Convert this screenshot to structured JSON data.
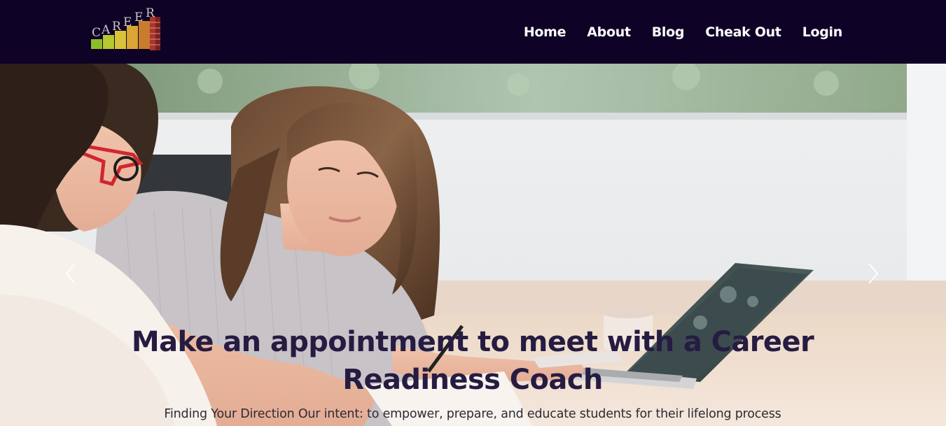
{
  "brand": {
    "logo_text": "CAREER",
    "logo_icon": "career-ladder-logo"
  },
  "nav": {
    "items": [
      {
        "label": "Home"
      },
      {
        "label": "About"
      },
      {
        "label": "Blog"
      },
      {
        "label": "Cheak Out"
      },
      {
        "label": "Login"
      }
    ]
  },
  "hero": {
    "title": "Make an appointment to meet with a Career Readiness Coach",
    "subtitle": "Finding Your Direction Our intent: to empower, prepare, and educate students for their lifelong process",
    "prev_icon": "chevron-left-icon",
    "next_icon": "chevron-right-icon"
  },
  "colors": {
    "navbar_bg": "#0e0226",
    "nav_text": "#ffffff",
    "hero_title": "#261c42",
    "hero_subtitle": "#2e2a33"
  }
}
